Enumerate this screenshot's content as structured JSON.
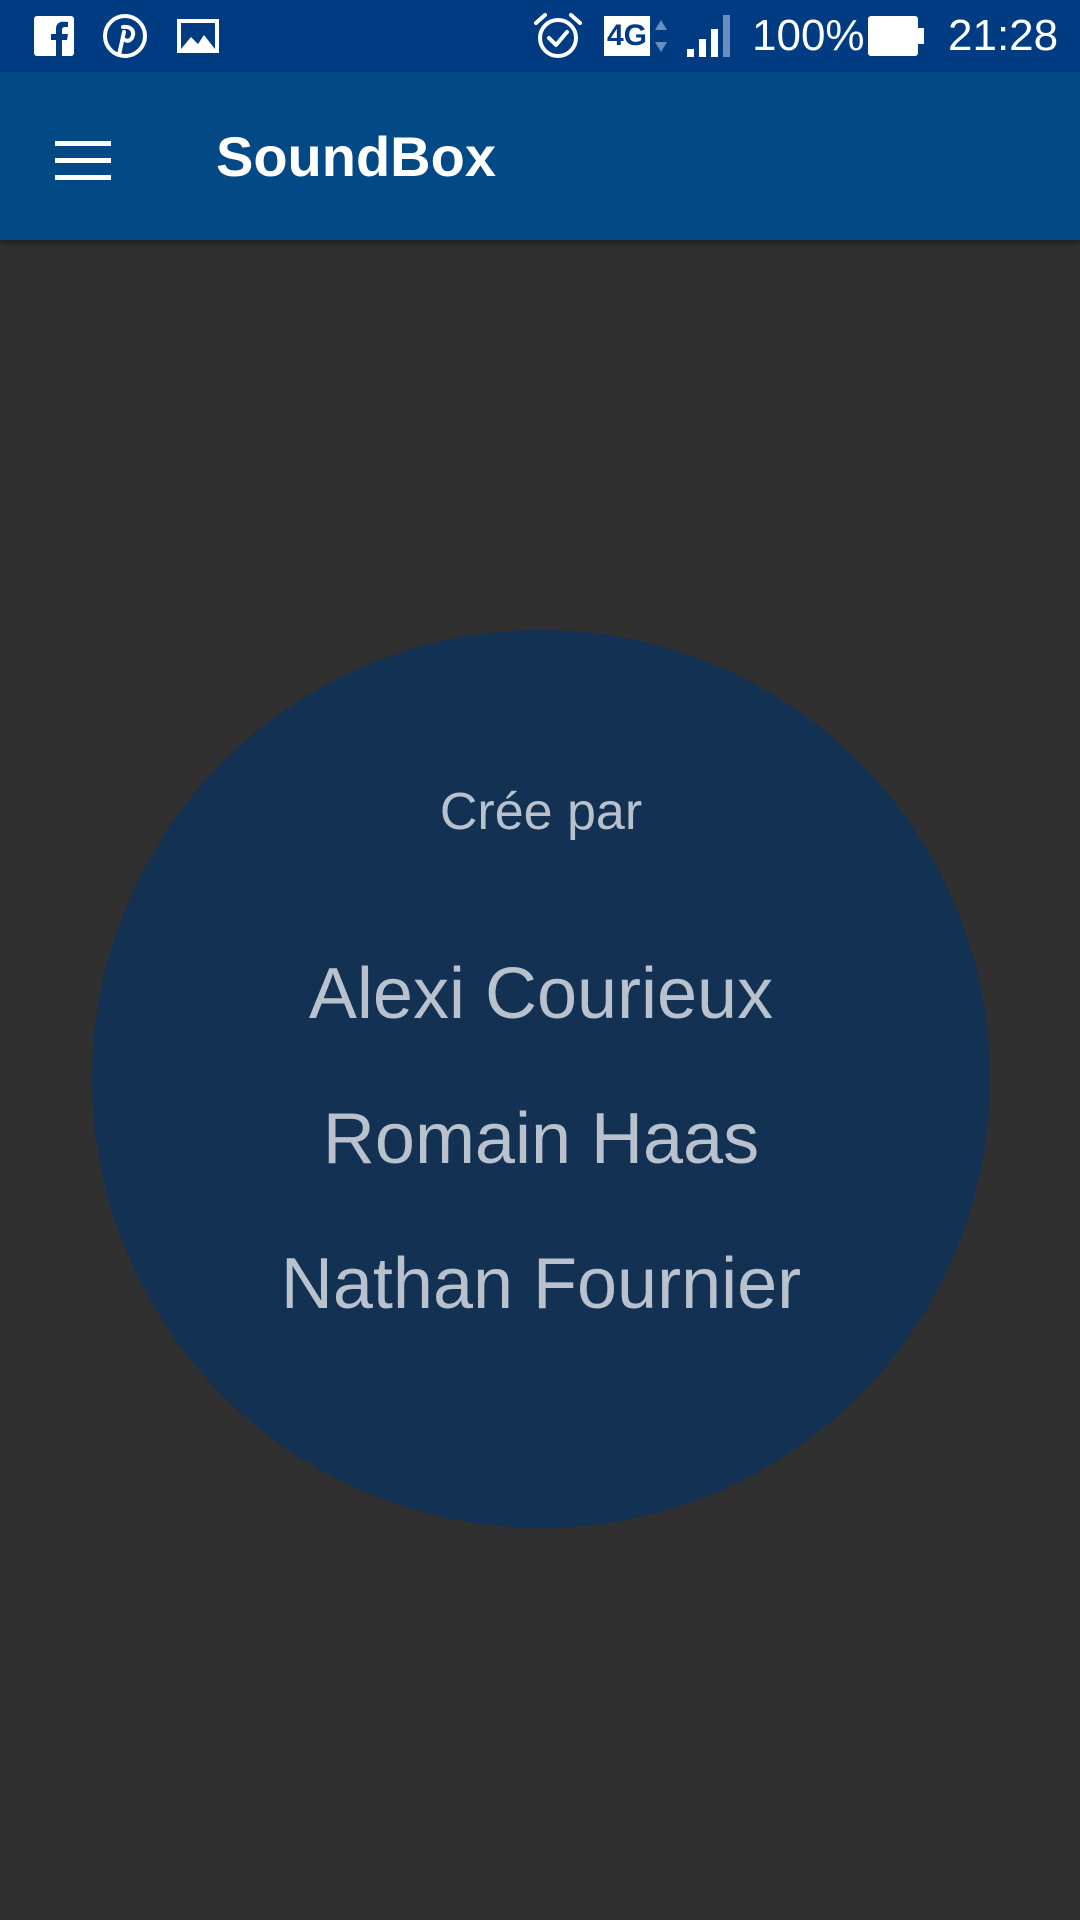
{
  "status_bar": {
    "notification_icons": [
      "facebook-icon",
      "pinterest-icon",
      "gallery-icon"
    ],
    "alarm_icon": "alarm-icon",
    "network_type": "4G",
    "signal_icon": "signal-icon",
    "battery_percent": "100%",
    "battery_icon": "battery-icon",
    "time": "21:28"
  },
  "app_bar": {
    "menu_icon": "hamburger-menu-icon",
    "title": "SoundBox"
  },
  "credits": {
    "heading": "Crée par",
    "authors": [
      "Alexi Courieux",
      "Romain Haas",
      "Nathan Fournier"
    ]
  },
  "colors": {
    "status_bar": "#013b82",
    "app_bar": "#024985",
    "background": "#303030",
    "circle": "#123153",
    "credits_text": "#b9c1cc"
  }
}
